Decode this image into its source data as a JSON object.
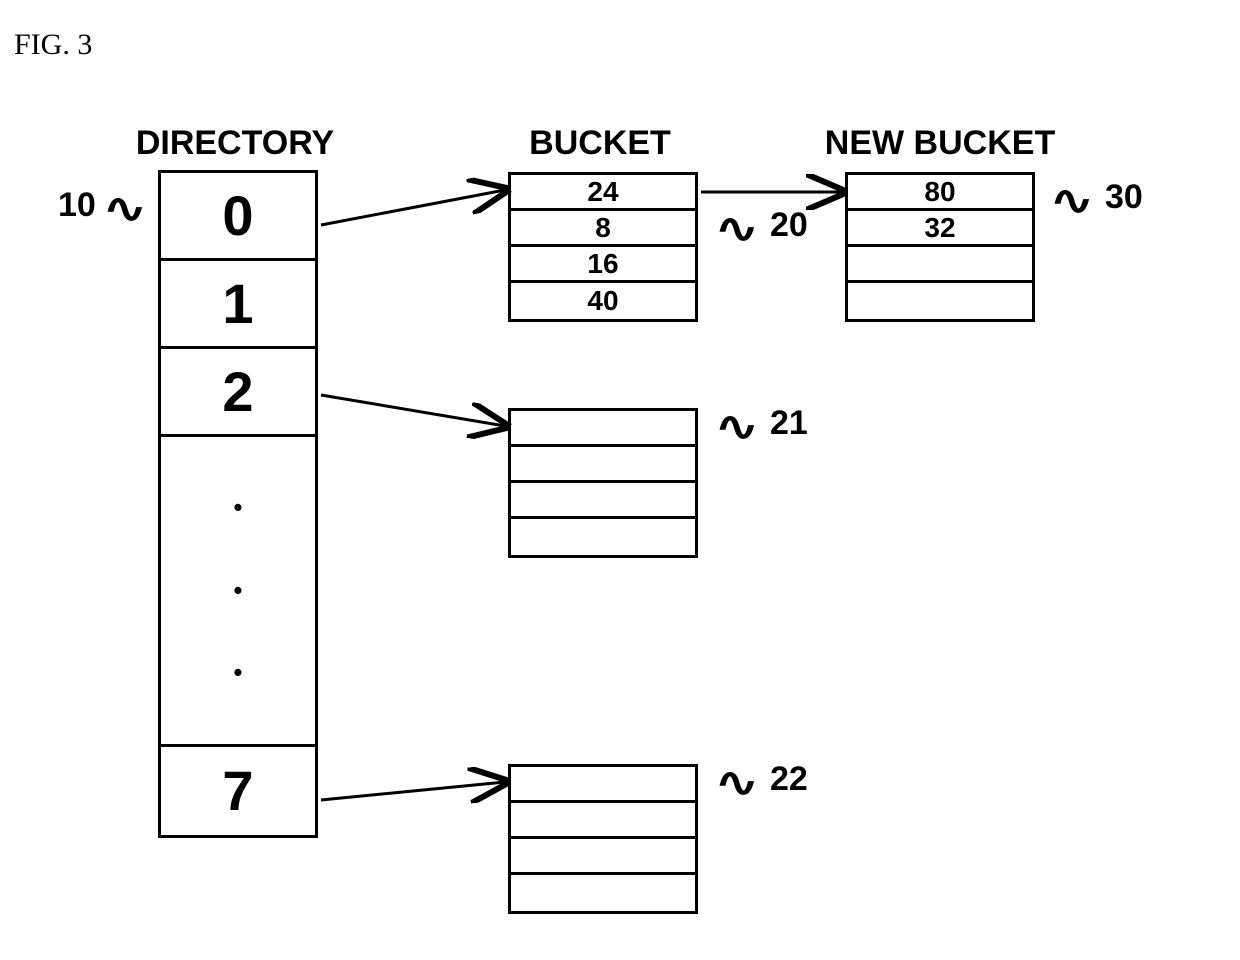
{
  "figureLabel": "FIG. 3",
  "headers": {
    "directory": "DIRECTORY",
    "bucket": "BUCKET",
    "newBucket": "NEW BUCKET"
  },
  "directory": {
    "cells": [
      "0",
      "1",
      "2",
      "7"
    ],
    "dots": [
      "·",
      "·",
      "·"
    ]
  },
  "buckets": {
    "b20": [
      "24",
      "8",
      "16",
      "40"
    ],
    "b21": [
      "",
      "",
      "",
      ""
    ],
    "b22": [
      "",
      "",
      "",
      ""
    ],
    "b30": [
      "80",
      "32",
      "",
      ""
    ]
  },
  "refs": {
    "r10": "10",
    "r20": "20",
    "r21": "21",
    "r22": "22",
    "r30": "30"
  }
}
